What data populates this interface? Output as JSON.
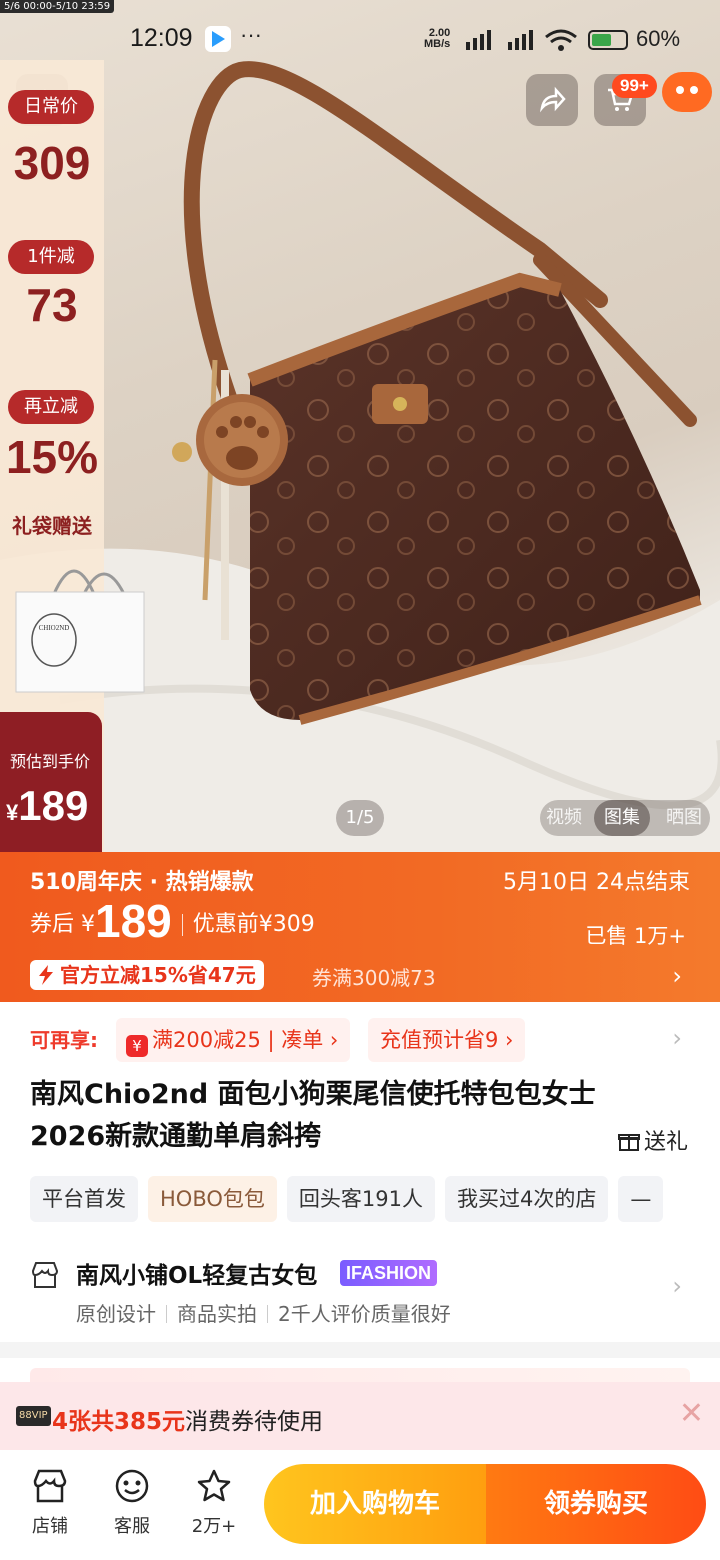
{
  "promo_tag": "5/6 00:00-5/10 23:59",
  "status_bar": {
    "time": "12:09",
    "dots": "···",
    "net_speed": "2.00",
    "net_unit": "MB/s",
    "battery": "60%",
    "battery_level": 0.6
  },
  "top_actions": {
    "cart_badge": "99+"
  },
  "price_column": {
    "daily_label": "日常价",
    "daily_value": "309",
    "minus_label": "1件减",
    "minus_value": "73",
    "extra_label": "再立减",
    "extra_value": "15%",
    "gift_text": "礼袋赠送",
    "gift_bag_brand": "CHIO2ND",
    "estimate_label": "预估到手价",
    "estimate_currency": "¥",
    "estimate_value": "189"
  },
  "gallery": {
    "page_indicator": "1/5",
    "tabs": [
      "视频",
      "图集",
      "晒图"
    ],
    "active_tab": "图集"
  },
  "banner": {
    "event": "510周年庆 · 热销爆款",
    "ends": "5月10日 24点结束",
    "after_coupon_label": "券后",
    "currency": "¥",
    "price": "189",
    "before_label": "优惠前¥309",
    "sold": "已售 1万+",
    "official_off": "官方立减15%省47元",
    "coupon_rule": "券满300减73"
  },
  "offers": {
    "label": "可再享:",
    "coupon_icon": "¥",
    "coupon": "满200减25",
    "coupon_action": "凑单",
    "recharge": "充值预计省9"
  },
  "product": {
    "title": "南风Chio2nd 面包小狗栗尾信使托特包包女士2026新款通勤单肩斜挎",
    "gift_link": "送礼"
  },
  "chips": [
    "平台首发",
    "HOBO包包",
    "回头客191人",
    "我买过4次的店",
    "—"
  ],
  "store": {
    "name": "南风小铺OL轻复古女包",
    "badge": "IFASHION",
    "features": [
      "原创设计",
      "商品实拍",
      "2千人评价质量很好"
    ]
  },
  "voucher": {
    "vip": "88VIP",
    "count_text": "4张共385元",
    "rest_text": "消费券待使用"
  },
  "bottom_nav": {
    "store": "店铺",
    "service": "客服",
    "favorites": "2万+",
    "add_to_cart": "加入购物车",
    "buy": "领券购买"
  },
  "colors": {
    "banner_orange": "#f05a1e",
    "price_red": "#8d2020",
    "accent_red": "#e8341a",
    "cart_yellow": "#ffc51e",
    "buy_orange": "#ff4c14"
  }
}
